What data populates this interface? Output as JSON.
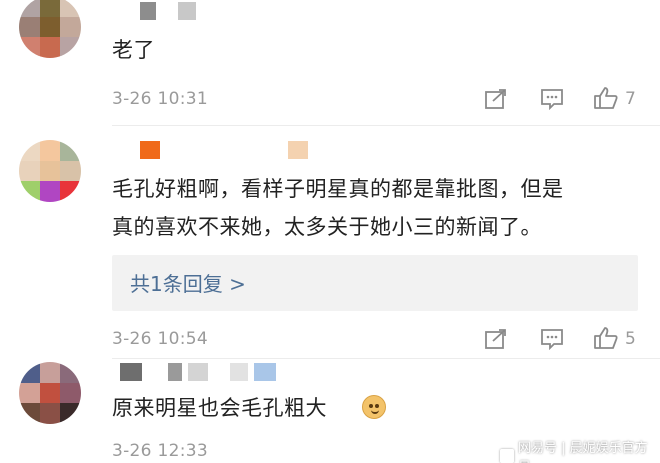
{
  "comments": [
    {
      "text": "老了",
      "timestamp": "3-26 10:31",
      "likes": "7",
      "avatar_colors": [
        "#b0a3a3",
        "#7a6a3a",
        "#d8c4b4",
        "#9a7f75",
        "#7d5e2e",
        "#c3a89a",
        "#d0806f",
        "#c86a4f",
        "#b8a3a3"
      ]
    },
    {
      "text_line1": "毛孔好粗啊，看样子明星真的都是靠批图，但是",
      "text_line2": "真的喜欢不来她，太多关于她小三的新闻了。",
      "reply_link": "共1条回复 >",
      "timestamp": "3-26 10:54",
      "likes": "5",
      "avatar_colors": [
        "#ecd8c2",
        "#f4c79e",
        "#a8b59a",
        "#e8d2bb",
        "#e7c29a",
        "#d8c2a8",
        "#9fcf6a",
        "#b046c2",
        "#e8343a"
      ]
    },
    {
      "text": "原来明星也会毛孔粗大",
      "timestamp": "3-26 12:33",
      "avatar_colors": [
        "#4f5e8a",
        "#c79f9a",
        "#8a6a7a",
        "#d3a196",
        "#c1503f",
        "#8e5a6a",
        "#6c4a3a",
        "#8a5046",
        "#3a2a2a"
      ]
    }
  ],
  "watermark": "网易号 | 晨妮娱乐官方号",
  "icon_names": [
    "share-icon",
    "comment-icon",
    "thumbs-up-icon",
    "doge-emoji-icon"
  ]
}
